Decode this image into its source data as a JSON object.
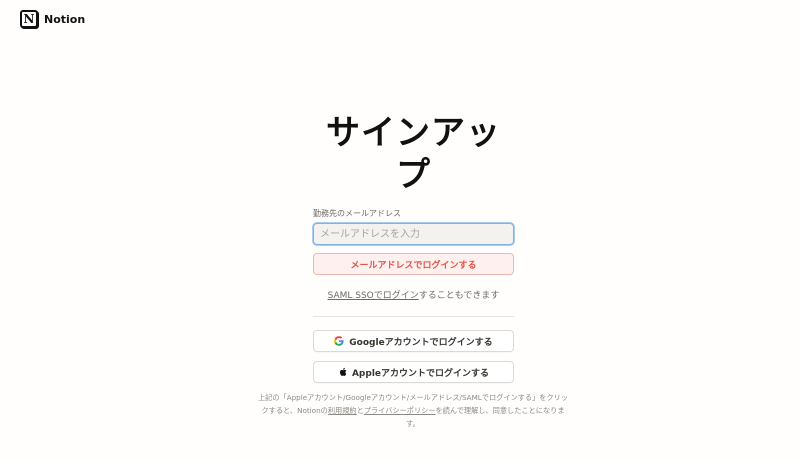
{
  "app": {
    "brand": "Notion",
    "logo_letter": "N"
  },
  "signup": {
    "title": "サインアップ",
    "email_label": "勤務先のメールアドレス",
    "email_placeholder": "メールアドレスを入力",
    "email_login_button": "メールアドレスでログインする",
    "saml_link": "SAML SSOでログイン",
    "saml_suffix": "することもできます",
    "google_button": "Googleアカウントでログインする",
    "apple_button": "Appleアカウントでログインする"
  },
  "footer": {
    "text_1": "上記の「Appleアカウント/Googleアカウント/メールアドレス/SAMLでログインする」をクリックすると、Notionの",
    "terms_link": "利用規約",
    "text_2": "と",
    "privacy_link": "プライバシーポリシー",
    "text_3": "を読んで理解し、同意したことになります。"
  },
  "colors": {
    "accent_blue": "#7fb3e6",
    "login_red": "#e0554a",
    "login_bg": "#fdf0ef"
  },
  "icons": [
    "notion-logo-icon",
    "google-icon",
    "apple-icon"
  ]
}
